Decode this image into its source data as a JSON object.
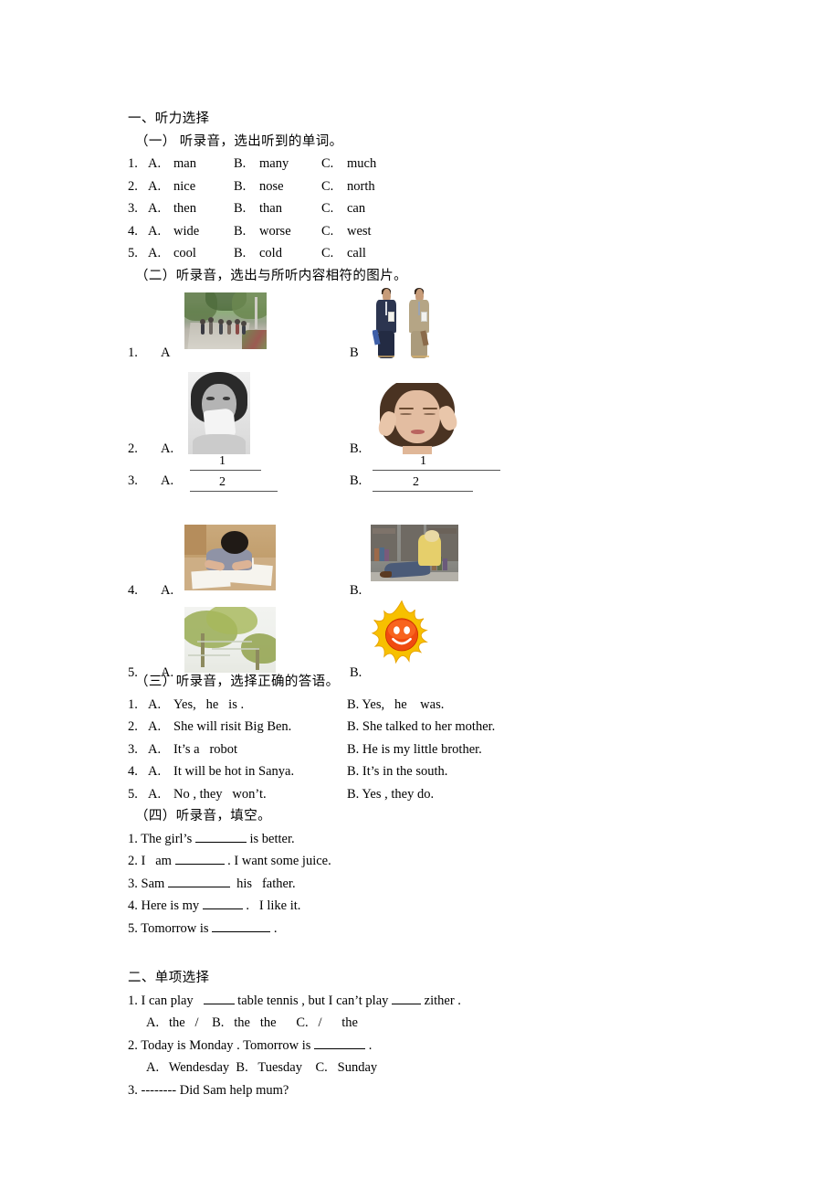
{
  "document": {
    "sections": [
      {
        "id": "section-one",
        "heading": "一、听力选择",
        "parts": [
          {
            "id": "part-1",
            "heading": "（一） 听录音，选出听到的单词。",
            "questions": [
              {
                "num": "1.",
                "a_label": "A.",
                "a": "man",
                "b_label": "B.",
                "b": "many",
                "c_label": "C.",
                "c": "much"
              },
              {
                "num": "2.",
                "a_label": "A.",
                "a": "nice",
                "b_label": "B.",
                "b": "nose",
                "c_label": "C.",
                "c": "north"
              },
              {
                "num": "3.",
                "a_label": "A.",
                "a": "then",
                "b_label": "B.",
                "b": "than",
                "c_label": "C.",
                "c": "can"
              },
              {
                "num": "4.",
                "a_label": "A.",
                "a": "wide",
                "b_label": "B.",
                "b": "worse",
                "c_label": "C.",
                "c": "west"
              },
              {
                "num": "5.",
                "a_label": "A.",
                "a": "cool",
                "b_label": "B.",
                "b": "cold",
                "c_label": "C.",
                "c": "call"
              }
            ]
          },
          {
            "id": "part-2",
            "heading": "（二）听录音，选出与所听内容相符的图片。",
            "questions": [
              {
                "num": "1.",
                "a_label": "A",
                "b_label": "B",
                "a_image": "street-with-people-photo",
                "b_image": "two-men-in-uniform-photo"
              },
              {
                "num": "2.",
                "a_label": "A.",
                "b_label": "B.",
                "a_image": "woman-sneezing-photo",
                "b_image": "woman-with-headache-photo"
              },
              {
                "num": "3.",
                "a_label": "A.",
                "b_label": "B.",
                "a_image": "blank-lines-short",
                "b_image": "blank-lines-long",
                "line_labels": [
                  "1",
                  "2"
                ]
              },
              {
                "num": "4.",
                "a_label": "A.",
                "b_label": "B.",
                "a_image": "boy-studying-photo",
                "b_image": "girl-reading-in-library-photo"
              },
              {
                "num": "5.",
                "a_label": "A.",
                "b_label": "B.",
                "a_image": "windy-trees-photo",
                "b_image": "smiling-sun-clipart"
              }
            ]
          },
          {
            "id": "part-3",
            "heading": "（三）听录音，选择正确的答语。",
            "questions": [
              {
                "num": "1.",
                "a_label": "A.",
                "a": "Yes,   he   is .",
                "b": "B. Yes,   he    was."
              },
              {
                "num": "2.",
                "a_label": "A.",
                "a": "She will risit Big Ben.",
                "b": "B. She talked to her mother."
              },
              {
                "num": "3.",
                "a_label": "A.",
                "a": "It’s a   robot",
                "b": "B. He is my little brother."
              },
              {
                "num": "4.",
                "a_label": "A.",
                "a": "It will be hot in Sanya.",
                "b": "B. It’s in the south."
              },
              {
                "num": "5.",
                "a_label": "A.",
                "a": "No , they   won’t.",
                "b": "B. Yes , they do."
              }
            ]
          },
          {
            "id": "part-4",
            "heading": "（四）听录音，填空。",
            "questions": [
              {
                "num": "1.",
                "before": "The girl’s ",
                "blank_width": 56,
                "after": " is better."
              },
              {
                "num": "2.",
                "before": "I   am ",
                "blank_width": 54,
                "after": " . I want some juice."
              },
              {
                "num": "3.",
                "before": "Sam ",
                "blank_width": 68,
                "after": "  his   father."
              },
              {
                "num": "4.",
                "before": "Here is my ",
                "blank_width": 44,
                "after": " .   I like it."
              },
              {
                "num": "5.",
                "before": "Tomorrow is ",
                "blank_width": 64,
                "after": " ."
              }
            ]
          }
        ]
      },
      {
        "id": "section-two",
        "heading": "二、单项选择",
        "questions": [
          {
            "num": "1.",
            "stem_before": "I can play   ",
            "stem_blank1": 34,
            "stem_mid": " table tennis , but I can’t play ",
            "stem_blank2": 32,
            "stem_after": " zither .",
            "choices": "A.   the   /    B.   the   the      C.   /      the"
          },
          {
            "num": "2.",
            "stem_before": "Today is Monday . Tomorrow is ",
            "stem_blank1": 56,
            "stem_after": " .",
            "choices": "A.   Wendesday  B.   Tuesday    C.   Sunday"
          },
          {
            "num": "3.",
            "stem_before": "-------- Did Sam help mum?",
            "choices": ""
          }
        ]
      }
    ]
  }
}
